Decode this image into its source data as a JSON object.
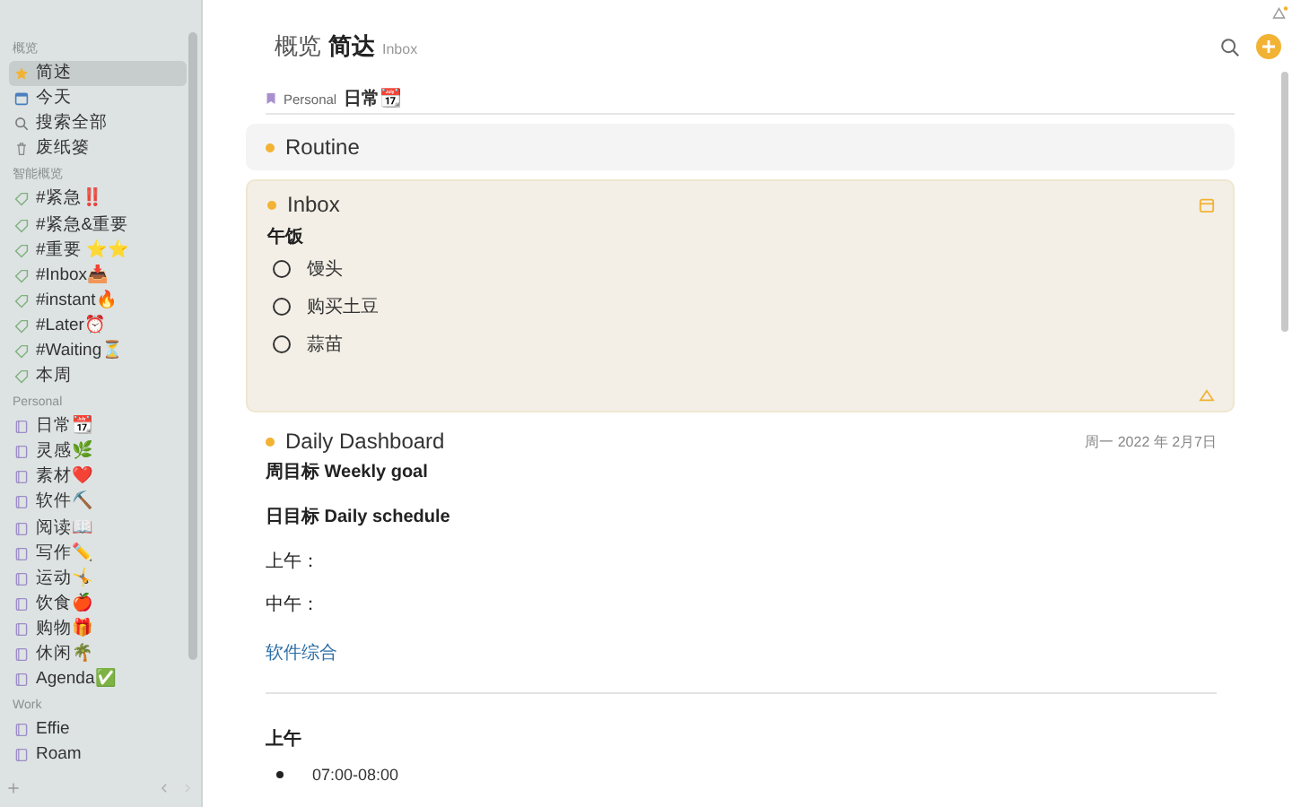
{
  "sidebar": {
    "sections": [
      {
        "title": "概览",
        "items": [
          {
            "label": "简述",
            "kind": "star",
            "selected": true
          },
          {
            "label": "今天",
            "kind": "calendar",
            "selected": false
          },
          {
            "label": "搜索全部",
            "kind": "search",
            "selected": false
          },
          {
            "label": "废纸篓",
            "kind": "trash",
            "selected": false
          }
        ]
      },
      {
        "title": "智能概览",
        "items": [
          {
            "label": "#紧急‼️",
            "kind": "tag",
            "selected": false
          },
          {
            "label": "#紧急&重要",
            "kind": "tag",
            "selected": false
          },
          {
            "label": "#重要 ⭐⭐",
            "kind": "tag",
            "selected": false
          },
          {
            "label": "#Inbox📥",
            "kind": "tag",
            "selected": false
          },
          {
            "label": "#instant🔥",
            "kind": "tag",
            "selected": false
          },
          {
            "label": "#Later⏰",
            "kind": "tag",
            "selected": false
          },
          {
            "label": "#Waiting⏳",
            "kind": "tag",
            "selected": false
          },
          {
            "label": "本周",
            "kind": "tag",
            "selected": false
          }
        ]
      },
      {
        "title": "Personal",
        "items": [
          {
            "label": "日常📆",
            "kind": "notebook",
            "selected": false
          },
          {
            "label": "灵感🌿",
            "kind": "notebook",
            "selected": false
          },
          {
            "label": "素材❤️",
            "kind": "notebook",
            "selected": false
          },
          {
            "label": "软件⛏️",
            "kind": "notebook",
            "selected": false
          },
          {
            "label": "阅读📖",
            "kind": "notebook",
            "selected": false
          },
          {
            "label": "写作✏️",
            "kind": "notebook",
            "selected": false
          },
          {
            "label": "运动🤸",
            "kind": "notebook",
            "selected": false
          },
          {
            "label": "饮食🍎",
            "kind": "notebook",
            "selected": false
          },
          {
            "label": "购物🎁",
            "kind": "notebook",
            "selected": false
          },
          {
            "label": "休闲🌴",
            "kind": "notebook",
            "selected": false
          },
          {
            "label": "Agenda✅",
            "kind": "notebook",
            "selected": false
          }
        ]
      },
      {
        "title": "Work",
        "items": [
          {
            "label": "Effie",
            "kind": "notebook",
            "selected": false
          },
          {
            "label": "Roam",
            "kind": "notebook",
            "selected": false
          }
        ]
      }
    ]
  },
  "header": {
    "title_muted": "概览",
    "title": "简达",
    "subtitle": "Inbox"
  },
  "breadcrumb": {
    "notebook": "Personal",
    "page": "日常📆"
  },
  "cards": [
    {
      "title": "Routine",
      "expanded": false,
      "selected": false
    },
    {
      "title": "Inbox",
      "expanded": true,
      "selected": true,
      "heading": "午饭",
      "todos": [
        {
          "text": "馒头",
          "checked": false
        },
        {
          "text": "购买土豆",
          "checked": false
        },
        {
          "text": "蒜苗",
          "checked": false
        }
      ]
    }
  ],
  "note": {
    "title": "Daily Dashboard",
    "date": "周一 2022 年 2月7日",
    "blocks": [
      {
        "kind": "heading",
        "text": "周目标 Weekly goal"
      },
      {
        "kind": "heading",
        "text": "日目标 Daily schedule"
      },
      {
        "kind": "label",
        "text": "上午："
      },
      {
        "kind": "label",
        "text": "中午："
      },
      {
        "kind": "link",
        "text": "软件综合"
      },
      {
        "kind": "rule"
      },
      {
        "kind": "section",
        "text": "上午"
      },
      {
        "kind": "bullet",
        "text": "07:00-08:00"
      }
    ]
  }
}
